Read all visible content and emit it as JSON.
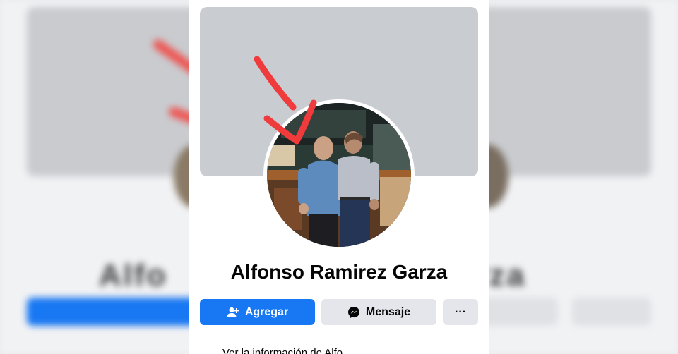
{
  "profile": {
    "name": "Alfonso Ramirez Garza"
  },
  "actions": {
    "add_friend_label": "Agregar",
    "message_label": "Mensaje",
    "more_label": "···"
  },
  "info": {
    "text": "Ver la información de Alfo..."
  },
  "colors": {
    "primary": "#1877f2",
    "secondary_button": "#e4e6eb",
    "cover": "#c9ccd1",
    "annotation": "#ef3b3b"
  },
  "icons": {
    "add_friend": "person-plus-icon",
    "message": "messenger-icon",
    "more": "ellipsis-icon"
  }
}
